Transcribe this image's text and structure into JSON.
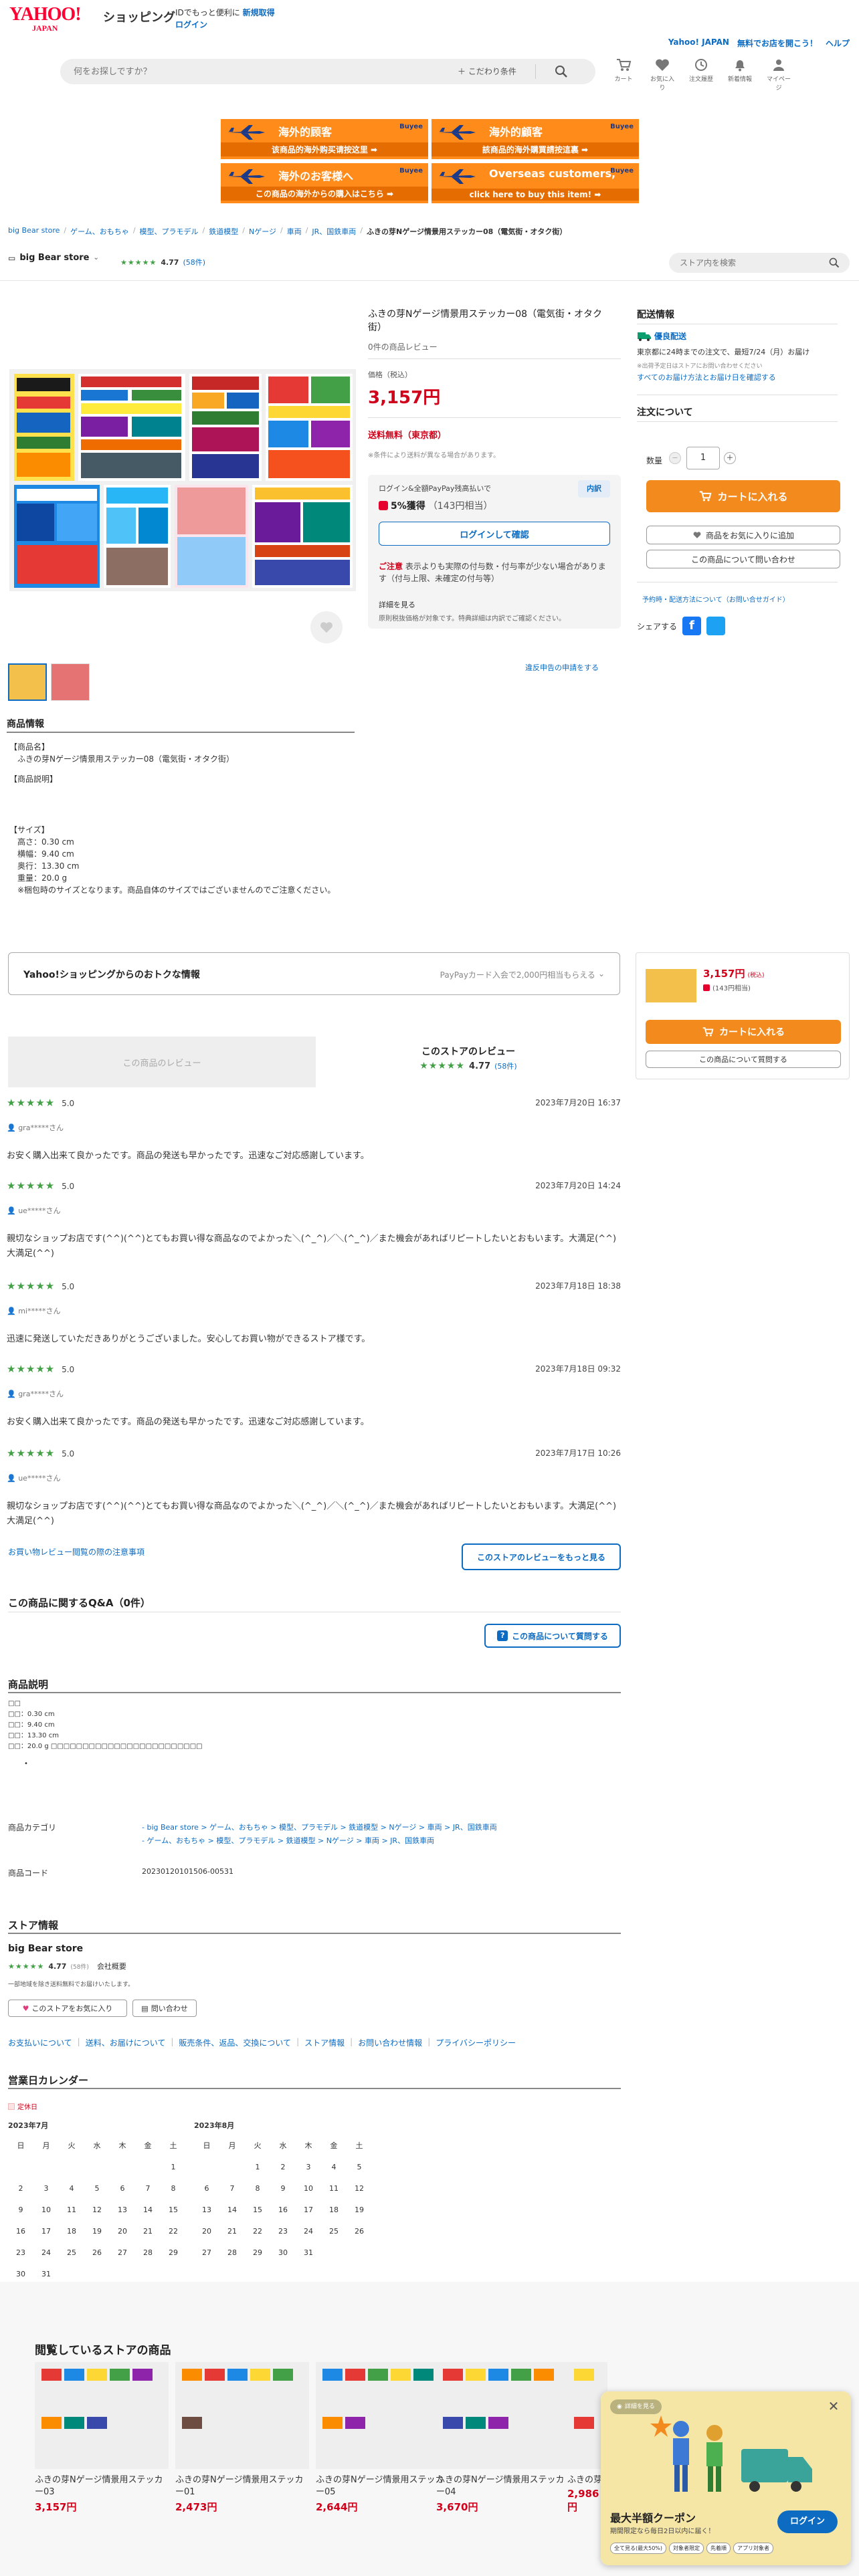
{
  "header": {
    "logo_line1": "YAHOO!",
    "logo_line2": "JAPAN",
    "service": "ショッピング",
    "promo": "IDでもっと便利に",
    "signup": "新規取得",
    "login": "ログイン",
    "top_right_link1": "Yahoo! JAPAN",
    "top_right_link2": "無料でお店を開こう！",
    "top_right_link3": "ヘルプ",
    "search_placeholder": "何をお探しですか？",
    "filter_label": "こだわり条件",
    "icons": [
      {
        "label": "カート",
        "icon": "cart-icon"
      },
      {
        "label": "お気に入り",
        "icon": "heart-icon"
      },
      {
        "label": "注文履歴",
        "icon": "history-icon"
      },
      {
        "label": "新着情報",
        "icon": "bell-icon"
      },
      {
        "label": "マイページ",
        "icon": "user-icon"
      }
    ]
  },
  "banners": [
    {
      "title": "海外的顾客",
      "sub": "该商品的海外购买请按这里 ➡",
      "brand": "Buyee"
    },
    {
      "title": "海外的顧客",
      "sub": "該商品的海外購買請按這裏 ➡",
      "brand": "Buyee"
    },
    {
      "title": "海外のお客様へ",
      "sub": "この商品の海外からの購入はこちら ➡",
      "brand": "Buyee"
    },
    {
      "title": "Overseas customers,",
      "sub": "click here to buy this item! ➡",
      "brand": "Buyee"
    }
  ],
  "breadcrumb": [
    "big Bear store",
    "ゲーム、おもちゃ",
    "模型、プラモデル",
    "鉄道模型",
    "Nゲージ",
    "車両",
    "JR、国鉄車両",
    "ふきの芽Nゲージ情景用ステッカー08（電気街・オタク街）"
  ],
  "store_bar": {
    "name": "big Bear store",
    "rating": "4.77",
    "count": "(58件)",
    "search_placeholder": "ストア内を検索"
  },
  "product": {
    "title": "ふきの芽Nゲージ情景用ステッカー08（電気街・オタク街）",
    "reviews": "0件の商品レビュー",
    "price_label": "価格（税込）",
    "price": "3,157円",
    "shipping": "送料無料（東京都）",
    "shipping_note": "※条件により送料が異なる場合があります。",
    "points_header": "ログイン&全額PayPay残高払いで",
    "points_detail_btn": "内訳",
    "points_value": "5%獲得",
    "points_amount": "（143円相当）",
    "login_confirm": "ログインして確認",
    "caution_label": "ご注意",
    "caution_text": "表示よりも実際の付与数・付与率が少ない場合があります（付与上限、未確定の付与等）",
    "caution_more": "詳細を見る",
    "caution_note": "原則税抜価格が対象です。特典詳細は内訳でご確認ください。",
    "report_link": "違反申告の申請をする"
  },
  "delivery": {
    "heading": "配送情報",
    "badge": "優良配送",
    "line1": "東京都に24時までの注文で、最短7/24（月）お届け",
    "line2": "※出荷予定日はストアにお問い合わせください",
    "line3": "すべてのお届け方法とお届け日を確認する"
  },
  "order": {
    "heading": "注文について",
    "qty_label": "数量",
    "qty_value": "1",
    "cart_btn": "カートに入れる",
    "fav_btn": "商品をお気に入りに追加",
    "ask_btn": "この商品について問い合わせ",
    "policy_link": "予約時・配送方法について（お問い合せガイド）",
    "share_label": "シェアする"
  },
  "info": {
    "heading": "商品情報",
    "name_label": "【商品名】",
    "name_value": "ふきの芽Nゲージ情景用ステッカー08（電気街・オタク街）",
    "desc_label": "【商品説明】",
    "size_label": "【サイズ】",
    "size_lines": [
      "高さ：0.30 cm",
      "横幅：9.40 cm",
      "奥行：13.30 cm",
      "重量：20.0 g",
      "※梱包時のサイズとなります。商品自体のサイズではございませんのでご注意ください。"
    ]
  },
  "deals": {
    "title": "Yahoo!ショッピングからのおトクな情報",
    "right": "PayPayカード入会で2,000円相当もらえる"
  },
  "side_card": {
    "price": "3,157円",
    "tax": "(税込)",
    "points": "(143円相当)",
    "cart": "カートに入れる",
    "ask": "この商品について質問する"
  },
  "reviews_section": {
    "empty_label": "この商品のレビュー",
    "store_label": "このストアのレビュー",
    "rating": "4.77",
    "count": "(58件)",
    "items": [
      {
        "score": "5.0",
        "date": "2023年7月20日 16:37",
        "user": "gra*****さん",
        "text": "お安く購入出来て良かったです。商品の発送も早かったです。迅速なご対応感謝しています。"
      },
      {
        "score": "5.0",
        "date": "2023年7月20日 14:24",
        "user": "ue*****さん",
        "text": "親切なショップお店です(^^)(^^)とてもお買い得な商品なのでよかった＼(^_^)／＼(^_^)／また機会があればリピートしたいとおもいます。大満足(^^)大満足(^^)"
      },
      {
        "score": "5.0",
        "date": "2023年7月18日 18:38",
        "user": "mi*****さん",
        "text": "迅速に発送していただきありがとうございました。安心してお買い物ができるストア様です。"
      },
      {
        "score": "5.0",
        "date": "2023年7月18日 09:32",
        "user": "gra*****さん",
        "text": "お安く購入出来て良かったです。商品の発送も早かったです。迅速なご対応感謝しています。"
      },
      {
        "score": "5.0",
        "date": "2023年7月17日 10:26",
        "user": "ue*****さん",
        "text": "親切なショップお店です(^^)(^^)とてもお買い得な商品なのでよかった＼(^_^)／＼(^_^)／また機会があればリピートしたいとおもいます。大満足(^^)大満足(^^)"
      }
    ],
    "guideline_link": "お買い物レビュー閲覧の際の注意事項",
    "more_btn": "このストアのレビューをもっと見る"
  },
  "qa": {
    "heading": "この商品に関するQ&A（0件）",
    "ask_btn": "この商品について質問する"
  },
  "desc": {
    "heading": "商品説明",
    "lines": [
      "□□",
      "□□：0.30 cm",
      "□□：9.40 cm",
      "□□：13.30 cm",
      "□□：20.0 g □□□□□□□□□□□□□□□□□□□□□□□□"
    ]
  },
  "meta": {
    "cat_label": "商品カテゴリ",
    "cat1": "- big Bear store > ゲーム、おもちゃ > 模型、プラモデル > 鉄道模型 > Nゲージ > 車両 > JR、国鉄車両",
    "cat2": "- ゲーム、おもちゃ > 模型、プラモデル > 鉄道模型 > Nゲージ > 車両 > JR、国鉄車両",
    "code_label": "商品コード",
    "code_value": "20230120101506-00531"
  },
  "store_info": {
    "heading": "ストア情報",
    "name": "big Bear store",
    "rating": "4.77",
    "count": "(58件)",
    "company": "会社概要",
    "note": "一部地域を除き送料無料でお届けいたします。",
    "fav_btn": "このストアをお気に入り",
    "ask_btn": "問い合わせ",
    "links": [
      "お支払いについて",
      "送料、お届けについて",
      "販売条件、返品、交換について",
      "ストア情報",
      "お問い合わせ情報",
      "プライバシーポリシー"
    ]
  },
  "calendar": {
    "heading": "営業日カレンダー",
    "legend": "定休日",
    "weekdays": [
      "日",
      "月",
      "火",
      "水",
      "木",
      "金",
      "土"
    ],
    "months": [
      {
        "title": "2023年7月",
        "weeks": [
          [
            "",
            "",
            "",
            "",
            "",
            "",
            "1"
          ],
          [
            "2",
            "3",
            "4",
            "5",
            "6",
            "7",
            "8"
          ],
          [
            "9",
            "10",
            "11",
            "12",
            "13",
            "14",
            "15"
          ],
          [
            "16",
            "17",
            "18",
            "19",
            "20",
            "21",
            "22"
          ],
          [
            "23",
            "24",
            "25",
            "26",
            "27",
            "28",
            "29"
          ],
          [
            "30",
            "31",
            "",
            "",
            "",
            "",
            ""
          ]
        ]
      },
      {
        "title": "2023年8月",
        "weeks": [
          [
            "",
            "",
            "1",
            "2",
            "3",
            "4",
            "5"
          ],
          [
            "6",
            "7",
            "8",
            "9",
            "10",
            "11",
            "12"
          ],
          [
            "13",
            "14",
            "15",
            "16",
            "17",
            "18",
            "19"
          ],
          [
            "20",
            "21",
            "22",
            "23",
            "24",
            "25",
            "26"
          ],
          [
            "27",
            "28",
            "29",
            "30",
            "31",
            "",
            ""
          ]
        ]
      }
    ]
  },
  "browsing": {
    "heading": "閲覧しているストアの商品",
    "items": [
      {
        "name": "ふきの芽Nゲージ情景用ステッカー03",
        "price": "3,157円"
      },
      {
        "name": "ふきの芽Nゲージ情景用ステッカー01",
        "price": "2,473円"
      },
      {
        "name": "ふきの芽Nゲージ情景用ステッカー05",
        "price": "2,644円"
      },
      {
        "name": "ふきの芽Nゲージ情景用ステッカー04",
        "price": "3,670円"
      },
      {
        "name": "ふきの芽Nゲージ情景用ステッカー",
        "price": "2,986円"
      }
    ]
  },
  "popup": {
    "tag": "詳細を見る",
    "title": "最大半額クーポン",
    "sub": "期間限定なら毎日2日以内に届く！",
    "login": "ログイン",
    "chips": [
      "全て見る(最大50%)",
      "対象者限定",
      "先着順",
      "アプリ対象者"
    ]
  },
  "colors": {
    "accent": "#0d6cc2",
    "price": "#d0021b",
    "cart": "#f28a1e",
    "star": "#43a047",
    "banner": "#ff8c1a"
  }
}
